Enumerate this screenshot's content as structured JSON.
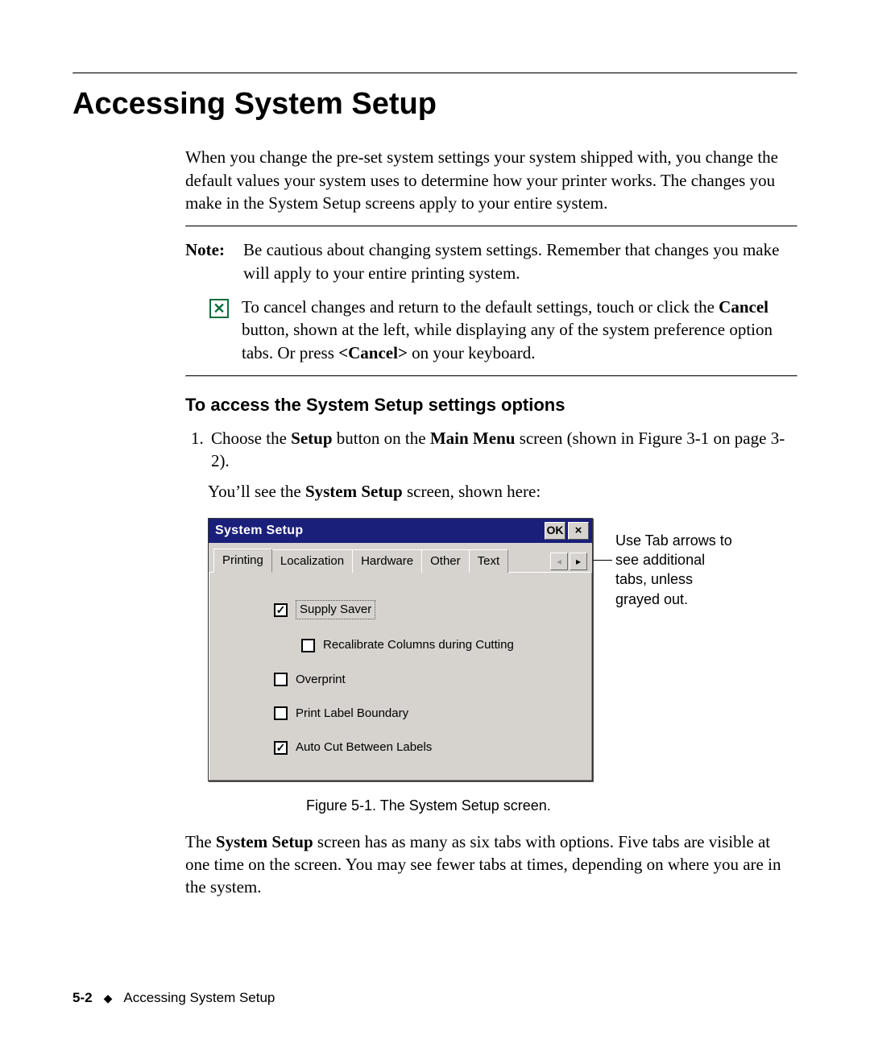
{
  "heading": "Accessing System Setup",
  "intro": "When you change the pre-set system settings your system shipped with, you change the default values your system uses to determine how your printer works. The changes you make in the System Setup screens apply to your entire system.",
  "note": {
    "label": "Note:",
    "text": "Be cautious about changing system settings. Remember that changes you make will apply to your entire printing system."
  },
  "cancel_tip": {
    "pre": "To cancel changes and return to the default settings, touch or click the ",
    "cancel_word": "Cancel",
    "mid1": " button, shown at the left, while displaying any of the system preference option tabs. Or press ",
    "cancel_key": "<Cancel>",
    "post": " on your keyboard."
  },
  "subhead": "To access the System Setup settings options",
  "step1": {
    "pre": "Choose the ",
    "setup_word": "Setup",
    "mid1": " button on the ",
    "menu_word": "Main Menu",
    "post": " screen (shown in Figure 3-1 on page 3-2)."
  },
  "step1b": {
    "pre": "You’ll see the ",
    "bold": "System Setup",
    "post": " screen, shown here:"
  },
  "dialog": {
    "title": "System Setup",
    "ok": "OK",
    "close": "×",
    "tabs": [
      "Printing",
      "Localization",
      "Hardware",
      "Other",
      "Text"
    ],
    "nav_left": "◂",
    "nav_right": "▸",
    "options": [
      {
        "label": "Supply Saver",
        "checked": true,
        "focused": true,
        "indent": false
      },
      {
        "label": "Recalibrate Columns during Cutting",
        "checked": false,
        "focused": false,
        "indent": true
      },
      {
        "label": "Overprint",
        "checked": false,
        "focused": false,
        "indent": false
      },
      {
        "label": "Print Label Boundary",
        "checked": false,
        "focused": false,
        "indent": false
      },
      {
        "label": "Auto Cut Between Labels",
        "checked": true,
        "focused": false,
        "indent": false
      }
    ]
  },
  "callout": "Use Tab arrows to see additional tabs, unless grayed out.",
  "figcap": "Figure 5-1. The System Setup screen.",
  "after": {
    "pre": "The ",
    "bold": "System Setup",
    "post": " screen has as many as six tabs with options. Five tabs are visible at one time on the screen. You may see fewer tabs at times, depending on where you are in the system."
  },
  "footer": {
    "page": "5-2",
    "section": "Accessing System Setup"
  }
}
